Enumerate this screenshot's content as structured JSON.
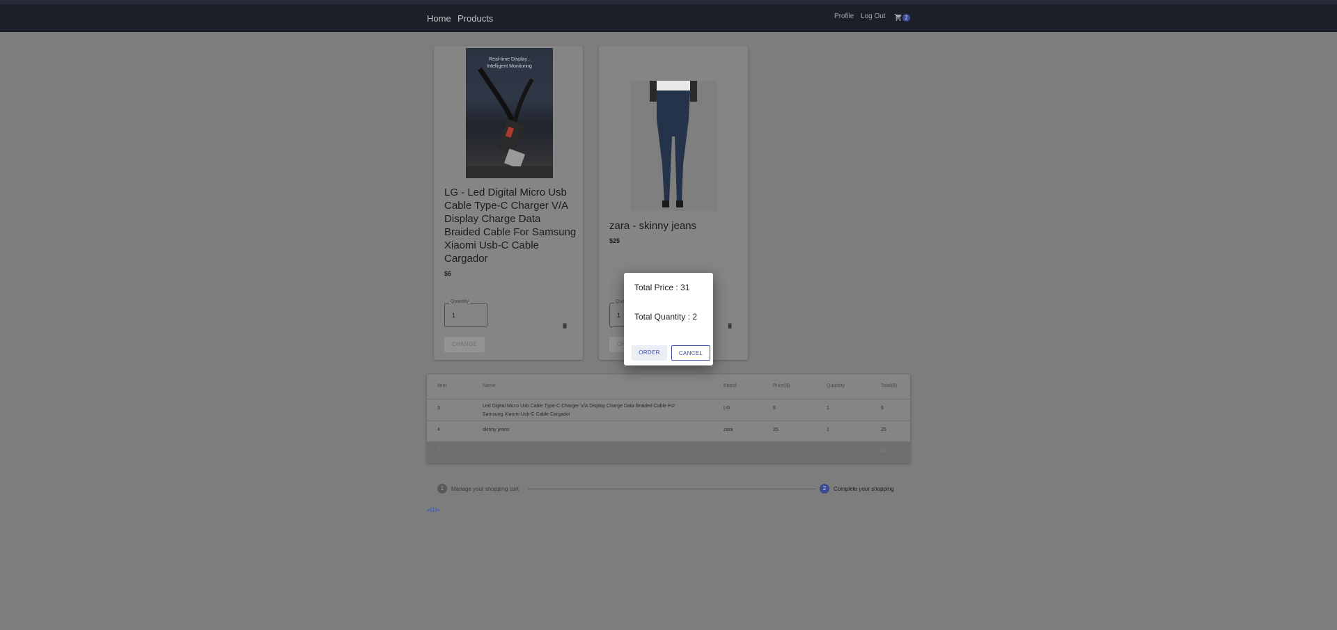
{
  "nav": {
    "home": "Home",
    "products": "Products",
    "profile": "Profile",
    "logout": "Log Out",
    "cart_count": "2"
  },
  "cards": [
    {
      "image_text": "Real-time Display ,\nIntelligent Monitoring",
      "title": "LG - Led Digital Micro Usb Cable Type-C Charger V/A Display Charge Data Braided Cable For Samsung Xiaomi Usb-C Cable Cargador",
      "price": "$6",
      "quantity_label": "Quantity",
      "quantity_value": "1",
      "change_label": "CHANGE"
    },
    {
      "title": "zara - skinny jeans",
      "price": "$25",
      "quantity_label": "Quantity",
      "quantity_value": "1",
      "change_label": "CHANGE"
    }
  ],
  "table": {
    "headers": [
      "Item",
      "Name",
      "Brand",
      "Price($)",
      "Quantity",
      "Total($)"
    ],
    "rows": [
      [
        "3",
        "Led Digital Micro Usb Cable Type-C Charger V/A Display Charge Data Braided Cable For Samsung Xiaomi Usb-C Cable Cargador",
        "LG",
        "6",
        "1",
        "6"
      ],
      [
        "4",
        "skinny jeans",
        "zara",
        "25",
        "1",
        "25"
      ]
    ],
    "total_row": [
      "2",
      "",
      "",
      "",
      "2",
      "31"
    ]
  },
  "stepper": {
    "step1_number": "1",
    "step1_label": "Manage your shopping cart",
    "step2_number": "2",
    "step2_label": "Complete your shopping"
  },
  "pager": "«(1)»",
  "dialog": {
    "total_price": "Total Price : 31",
    "total_quantity": "Total Quantity : 2",
    "order": "ORDER",
    "cancel": "CANCEL"
  },
  "colors": {
    "navbar": "#1c1f29",
    "overlay_background": "#7d7d7d",
    "accent": "#3b4a91",
    "dialog_button_text": "#3b4fa8"
  }
}
